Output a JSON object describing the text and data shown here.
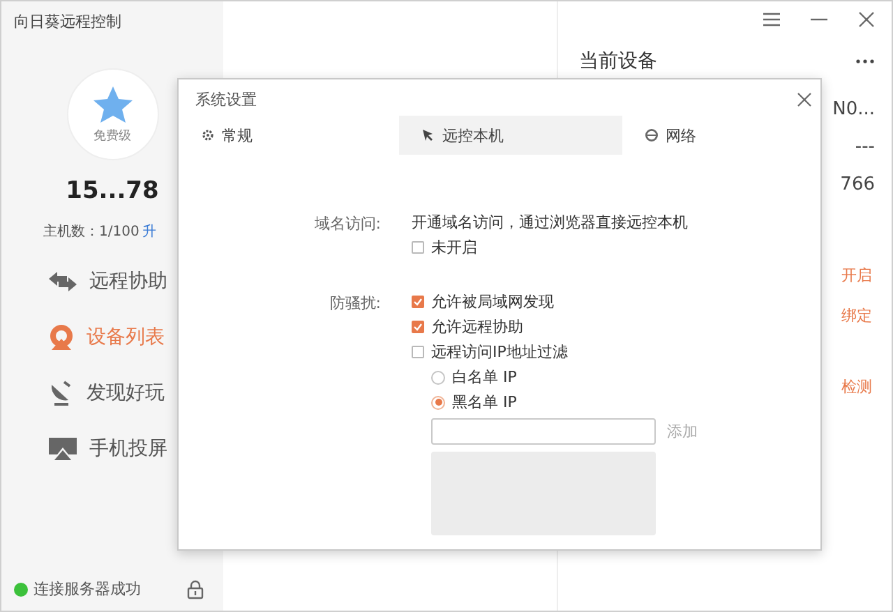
{
  "window": {
    "title": "向日葵远程控制"
  },
  "sidebar": {
    "account": {
      "badge": "免费级",
      "name": "15...78",
      "hosts": "主机数：1/100",
      "upgrade": "升"
    },
    "nav": [
      {
        "label": "远程协助",
        "kind": "assist",
        "selected": false
      },
      {
        "label": "设备列表",
        "kind": "devices",
        "selected": true
      },
      {
        "label": "发现好玩",
        "kind": "discover",
        "selected": false
      },
      {
        "label": "手机投屏",
        "kind": "cast",
        "selected": false
      }
    ],
    "status": {
      "text": "连接服务器成功",
      "connected": true
    }
  },
  "right_panel": {
    "title": "当前设备",
    "values": [
      "N0...",
      "---",
      "766"
    ],
    "actions": [
      "开启",
      "绑定",
      "检测"
    ]
  },
  "dialog": {
    "title": "系统设置",
    "tabs": [
      {
        "label": "常规",
        "kind": "general",
        "selected": false
      },
      {
        "label": "远控本机",
        "kind": "remote",
        "selected": true
      },
      {
        "label": "网络",
        "kind": "network",
        "selected": false
      }
    ],
    "domain": {
      "label": "域名访问:",
      "description": "开通域名访问，通过浏览器直接远控本机",
      "option": {
        "label": "未开启",
        "checked": false
      }
    },
    "anti_harass": {
      "label": "防骚扰:",
      "options": [
        {
          "label": "允许被局域网发现",
          "checked": true
        },
        {
          "label": "允许远程协助",
          "checked": true
        },
        {
          "label": "远程访问IP地址过滤",
          "checked": false
        }
      ],
      "ip_modes": [
        {
          "label": "白名单 IP",
          "selected": false
        },
        {
          "label": "黑名单 IP",
          "selected": true
        }
      ],
      "add": "添加"
    }
  }
}
